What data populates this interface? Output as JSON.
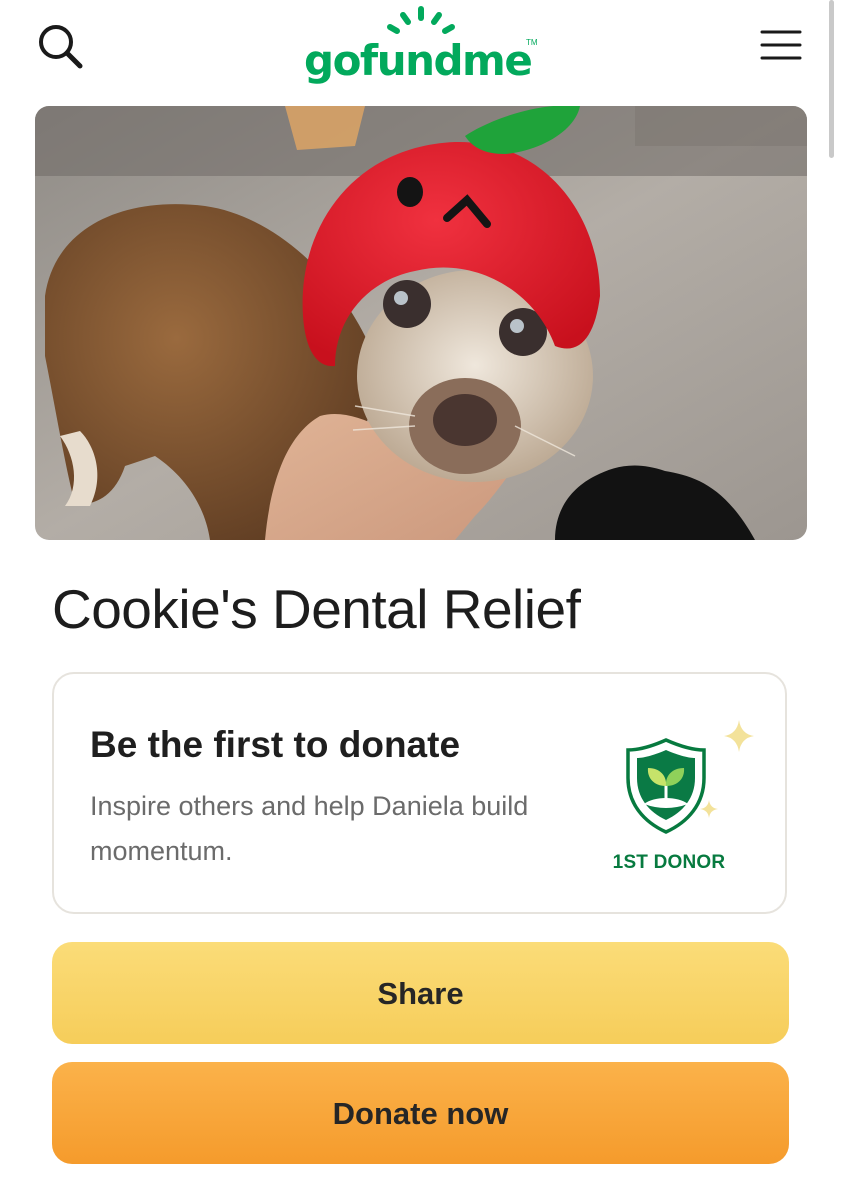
{
  "header": {
    "logo_text": "gofundme",
    "logo_tm": "TM",
    "search_icon": "search-icon",
    "menu_icon": "hamburger-menu-icon"
  },
  "hero": {
    "image_alt": "Small senior dog wearing a red apple hat, chin resting on a hand"
  },
  "campaign": {
    "title": "Cookie's Dental Relief"
  },
  "first_donor_card": {
    "heading": "Be the first to donate",
    "subtext": "Inspire others and help Daniela build momentum.",
    "badge_icon": "shield-sprout-icon",
    "badge_label": "1ST DONOR"
  },
  "actions": {
    "share_label": "Share",
    "donate_label": "Donate now"
  },
  "colors": {
    "brand_green": "#02a95c",
    "badge_green": "#077a3f",
    "share_yellow": "#f8d465",
    "donate_orange": "#f8a73b",
    "sparkle": "#f3e29a"
  }
}
